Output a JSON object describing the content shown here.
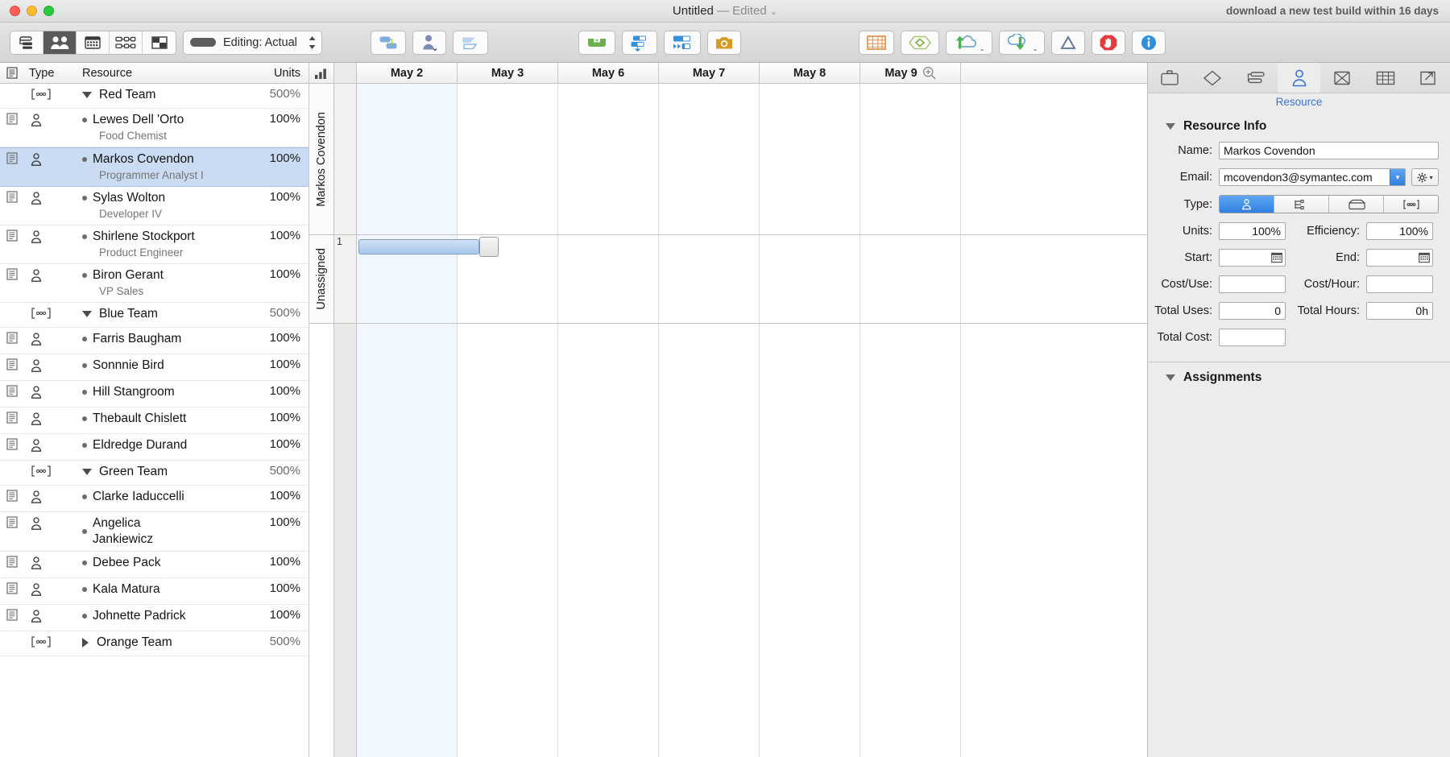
{
  "titlebar": {
    "doc_title": "Untitled",
    "dash": "—",
    "edited": "Edited",
    "chevron": "⌄",
    "right_notice": "download a new test build within 16 days"
  },
  "toolbar": {
    "view_segments": [
      {
        "name": "task-list-view",
        "icon": "task-list-icon",
        "active": false
      },
      {
        "name": "resource-view",
        "icon": "people-icon",
        "active": true
      },
      {
        "name": "calendar-view",
        "icon": "calendar-grid-icon",
        "active": false
      },
      {
        "name": "network-view",
        "icon": "network-diagram-icon",
        "active": false
      },
      {
        "name": "split-view",
        "icon": "split-panes-icon",
        "active": false
      }
    ],
    "editing_label": "Editing: Actual",
    "buttons": [
      {
        "name": "link-tasks-button",
        "icon": "link-tasks-icon"
      },
      {
        "name": "assign-resource-button",
        "icon": "person-assign-icon"
      },
      {
        "name": "indent-button",
        "icon": "shape-indent-icon"
      },
      {
        "name": "level-resources-button",
        "icon": "green-level-icon"
      },
      {
        "name": "baseline-button",
        "icon": "blue-bars-icon"
      },
      {
        "name": "progress-button",
        "icon": "progress-bars-icon"
      },
      {
        "name": "snapshot-button",
        "icon": "camera-icon"
      },
      {
        "name": "table-button",
        "icon": "orange-table-icon"
      },
      {
        "name": "diamond-button",
        "icon": "green-diamond-icon"
      },
      {
        "name": "upload-button",
        "icon": "cloud-upload-icon"
      },
      {
        "name": "download-button",
        "icon": "cloud-download-icon"
      },
      {
        "name": "warnings-button",
        "icon": "triangle-icon"
      },
      {
        "name": "stop-button",
        "icon": "stop-hand-icon"
      },
      {
        "name": "info-button",
        "icon": "info-icon"
      }
    ]
  },
  "table": {
    "columns": {
      "doc": "",
      "type": "Type",
      "resource": "Resource",
      "units": "Units"
    },
    "rows": [
      {
        "kind": "group",
        "name": "Red Team",
        "units": "500%",
        "expanded": true,
        "selected": false,
        "title": "",
        "doc": false
      },
      {
        "kind": "resource",
        "name": "Lewes Dell 'Orto",
        "units": "100%",
        "title": "Food Chemist",
        "selected": false,
        "doc": true
      },
      {
        "kind": "resource",
        "name": "Markos Covendon",
        "units": "100%",
        "title": "Programmer Analyst I",
        "selected": true,
        "doc": true
      },
      {
        "kind": "resource",
        "name": "Sylas Wolton",
        "units": "100%",
        "title": "Developer IV",
        "selected": false,
        "doc": true
      },
      {
        "kind": "resource",
        "name": "Shirlene Stockport",
        "units": "100%",
        "title": "Product Engineer",
        "selected": false,
        "doc": true
      },
      {
        "kind": "resource",
        "name": "Biron Gerant",
        "units": "100%",
        "title": "VP Sales",
        "selected": false,
        "doc": true
      },
      {
        "kind": "group",
        "name": "Blue Team",
        "units": "500%",
        "expanded": true,
        "selected": false,
        "title": "",
        "doc": false
      },
      {
        "kind": "resource",
        "name": "Farris Baugham",
        "units": "100%",
        "title": "",
        "selected": false,
        "doc": true
      },
      {
        "kind": "resource",
        "name": "Sonnnie Bird",
        "units": "100%",
        "title": "",
        "selected": false,
        "doc": true
      },
      {
        "kind": "resource",
        "name": "Hill Stangroom",
        "units": "100%",
        "title": "",
        "selected": false,
        "doc": true
      },
      {
        "kind": "resource",
        "name": "Thebault Chislett",
        "units": "100%",
        "title": "",
        "selected": false,
        "doc": true
      },
      {
        "kind": "resource",
        "name": "Eldredge Durand",
        "units": "100%",
        "title": "",
        "selected": false,
        "doc": true
      },
      {
        "kind": "group",
        "name": "Green Team",
        "units": "500%",
        "expanded": true,
        "selected": false,
        "title": "",
        "doc": false
      },
      {
        "kind": "resource",
        "name": "Clarke Iaduccelli",
        "units": "100%",
        "title": "",
        "selected": false,
        "doc": true
      },
      {
        "kind": "resource",
        "name": "Angelica Jankiewicz",
        "units": "100%",
        "title": "",
        "selected": false,
        "doc": true,
        "wrap": true
      },
      {
        "kind": "resource",
        "name": "Debee Pack",
        "units": "100%",
        "title": "",
        "selected": false,
        "doc": true
      },
      {
        "kind": "resource",
        "name": "Kala Matura",
        "units": "100%",
        "title": "",
        "selected": false,
        "doc": true
      },
      {
        "kind": "resource",
        "name": "Johnette Padrick",
        "units": "100%",
        "title": "",
        "selected": false,
        "doc": true
      },
      {
        "kind": "group",
        "name": "Orange Team",
        "units": "500%",
        "expanded": false,
        "selected": false,
        "title": "",
        "doc": false
      }
    ]
  },
  "gantt": {
    "days": [
      "May 2",
      "May 3",
      "May 6",
      "May 7",
      "May 8",
      "May 9"
    ],
    "lanes": [
      {
        "label": "Markos Covendon",
        "rows": []
      },
      {
        "label": "Unassigned",
        "rows": [
          {
            "number": "1",
            "bar": true
          }
        ]
      }
    ],
    "zoom_icon": "zoom-in-icon"
  },
  "inspector": {
    "tabs": [
      {
        "name": "project-tab",
        "icon": "briefcase-icon",
        "active": false
      },
      {
        "name": "milestone-tab",
        "icon": "diamond-icon",
        "active": false
      },
      {
        "name": "task-tab",
        "icon": "task-bars-icon",
        "active": false
      },
      {
        "name": "resource-tab",
        "icon": "person-icon",
        "active": true
      },
      {
        "name": "assignment-tab",
        "icon": "assignment-icon",
        "active": false
      },
      {
        "name": "table-tab",
        "icon": "table-icon",
        "active": false
      },
      {
        "name": "export-tab",
        "icon": "export-arrow-icon",
        "active": false
      }
    ],
    "active_tab_label": "Resource",
    "resource_info": {
      "section_title": "Resource Info",
      "name_label": "Name:",
      "name_value": "Markos Covendon",
      "email_label": "Email:",
      "email_value": "mcovendon3@symantec.com",
      "type_label": "Type:",
      "type_options": [
        {
          "name": "type-person",
          "icon": "person-icon",
          "selected": true
        },
        {
          "name": "type-equipment",
          "icon": "equipment-icon",
          "selected": false
        },
        {
          "name": "type-material",
          "icon": "box-icon",
          "selected": false
        },
        {
          "name": "type-group",
          "icon": "group-icon",
          "selected": false
        }
      ],
      "units_label": "Units:",
      "units_value": "100%",
      "efficiency_label": "Efficiency:",
      "efficiency_value": "100%",
      "start_label": "Start:",
      "start_value": "",
      "end_label": "End:",
      "end_value": "",
      "cost_use_label": "Cost/Use:",
      "cost_use_value": "",
      "cost_hour_label": "Cost/Hour:",
      "cost_hour_value": "",
      "total_uses_label": "Total Uses:",
      "total_uses_value": "0",
      "total_hours_label": "Total Hours:",
      "total_hours_value": "0h",
      "total_cost_label": "Total Cost:",
      "total_cost_value": "",
      "gear_icon": "gear-icon"
    },
    "assignments": {
      "section_title": "Assignments"
    }
  },
  "colors": {
    "accent_blue": "#3b73d6",
    "selection_blue": "#c9dcf4",
    "weekend_tint": "#f2f6fd",
    "bar_fill": "#a9c8ec"
  }
}
